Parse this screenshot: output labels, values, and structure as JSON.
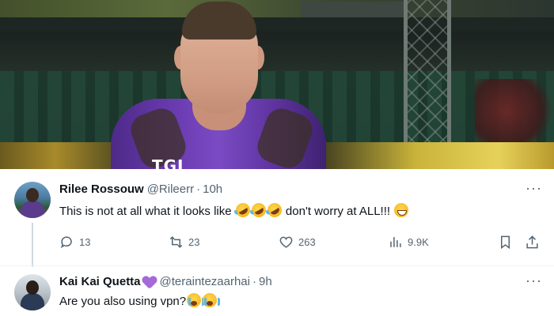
{
  "photo": {
    "shirt_text": "TGL"
  },
  "tweets": [
    {
      "name": "Rilee Rossouw",
      "handle": "@Rileerr",
      "separator": "·",
      "time": "10h",
      "text_before": "This is not at all what it looks like ",
      "text_middle": " don't worry at ALL!!! ",
      "emojis": [
        "rolling-on-floor-laughing",
        "rolling-on-floor-laughing",
        "rolling-on-floor-laughing",
        "grinning-face"
      ],
      "more_label": "···",
      "actions": {
        "replies": "13",
        "reposts": "23",
        "likes": "263",
        "views": "9.9K"
      }
    },
    {
      "name": "Kai Kai Quetta",
      "badge_icon": "purple-heart",
      "handle": "@teraintezaarhai",
      "separator": "·",
      "time": "9h",
      "text": "Are you also using vpn?",
      "emojis": [
        "loudly-crying-face",
        "loudly-crying-face"
      ],
      "more_label": "···"
    }
  ],
  "colors": {
    "secondary_text": "#536471",
    "primary_text": "#0f1419",
    "divider": "#eff3f4",
    "badge_purple": "#a46ad8"
  }
}
